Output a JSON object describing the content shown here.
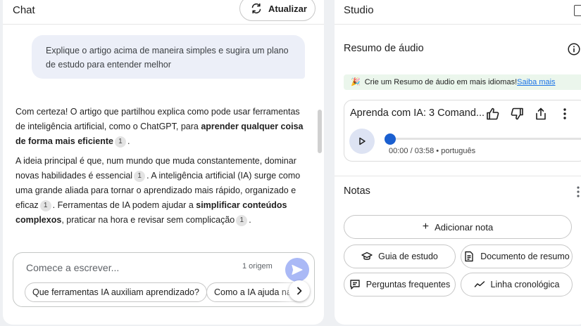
{
  "chat": {
    "title": "Chat",
    "refresh_label": "Atualizar",
    "user_message": "Explique o artigo acima de maneira simples e sugira um plano de estudo para entender melhor",
    "answer": {
      "p1_a": "Com certeza! O artigo que partilhou explica como pode usar ferramentas de inteligência artificial, como o ChatGPT, para ",
      "p1_b": "aprender qualquer coisa de forma mais eficiente",
      "p1_cite": "1",
      "p1_c": ".",
      "p2_a": "A ideia principal é que, num mundo que muda constantemente, dominar novas habilidades é essencial",
      "p2_cite1": "1",
      "p2_b": ". A inteligência artificial (IA) surge como uma grande aliada para tornar o aprendizado mais rápido, organizado e eficaz",
      "p2_cite2": "1",
      "p2_c": ". Ferramentas de IA podem ajudar a ",
      "p2_d": "simplificar conteúdos complexos",
      "p2_e": ", praticar na hora e revisar sem complicação",
      "p2_cite3": "1",
      "p2_f": "."
    },
    "composer": {
      "placeholder": "Comece a escrever...",
      "source_count": "1 origem",
      "suggestions": [
        "Que ferramentas IA auxiliam aprendizado?",
        "Como a IA ajuda na"
      ]
    }
  },
  "studio": {
    "title": "Studio",
    "audio_section_title": "Resumo de áudio",
    "promo_text": "Crie um Resumo de áudio em mais idiomas!",
    "promo_link": "Saiba mais",
    "audio_card": {
      "title": "Aprenda com IA: 3 Comand...",
      "time": "00:00 / 03:58",
      "separator": " • ",
      "language": "português",
      "progress": 0
    },
    "notes": {
      "title": "Notas",
      "add_note_label": "Adicionar nota",
      "buttons": [
        {
          "label": "Guia de estudo",
          "icon": "study-guide-icon"
        },
        {
          "label": "Documento de resumo",
          "icon": "summary-doc-icon"
        },
        {
          "label": "Perguntas frequentes",
          "icon": "faq-icon"
        },
        {
          "label": "Linha cronológica",
          "icon": "timeline-icon"
        }
      ]
    }
  },
  "colors": {
    "user_bubble": "#eceff8",
    "send_button": "#aab9f6",
    "link": "#1a73e8",
    "progress_knob": "#1a5fd0",
    "promo_bg": "#ebf6ec"
  }
}
